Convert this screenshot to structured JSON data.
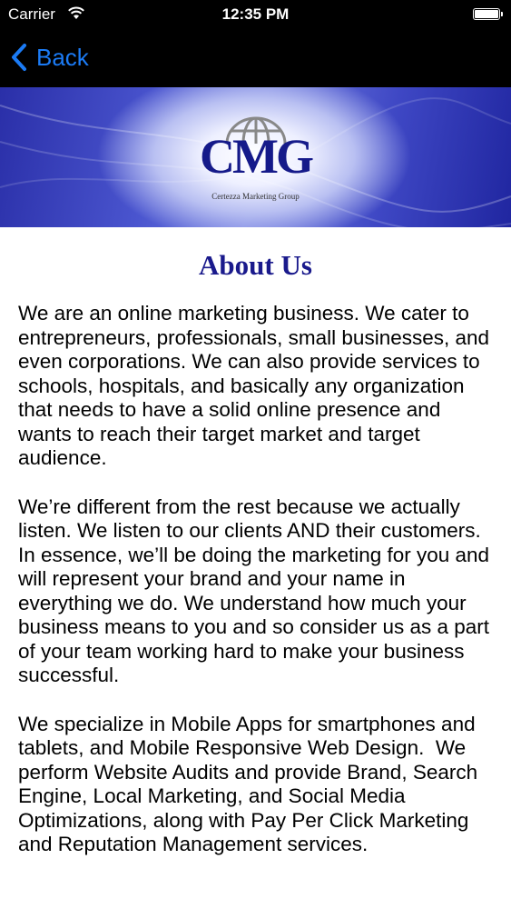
{
  "status_bar": {
    "carrier": "Carrier",
    "time": "12:35 PM",
    "icons": [
      "wifi-icon",
      "battery-icon"
    ]
  },
  "nav": {
    "back_label": "Back",
    "back_icon": "chevron-left-icon",
    "accent_color": "#1b7bf5"
  },
  "banner": {
    "logo_text": "CMG",
    "logo_subtitle": "Certezza Marketing Group",
    "logo_icon": "globe-icon"
  },
  "page": {
    "title": "About Us",
    "title_color": "#1a1a8c",
    "paragraphs": [
      "We are an online marketing business. We cater to entrepreneurs, professionals, small businesses, and even corporations. We can also provide services to schools, hospitals, and basically any organization that needs to have a solid online presence and wants to reach their target market and target audience.",
      "We’re different from the rest because we actually listen. We listen to our clients AND their customers. In essence, we’ll be doing the marketing for you and will represent your brand and your name in everything we do. We understand how much your business means to you and so consider us as a part of your team working hard to make your business successful.",
      "We specialize in Mobile Apps for smartphones and tablets, and Mobile Responsive Web Design.  We perform Website Audits and provide Brand, Search Engine, Local Marketing, and Social Media Optimizations, along with Pay Per Click Marketing and Reputation Management services."
    ]
  }
}
